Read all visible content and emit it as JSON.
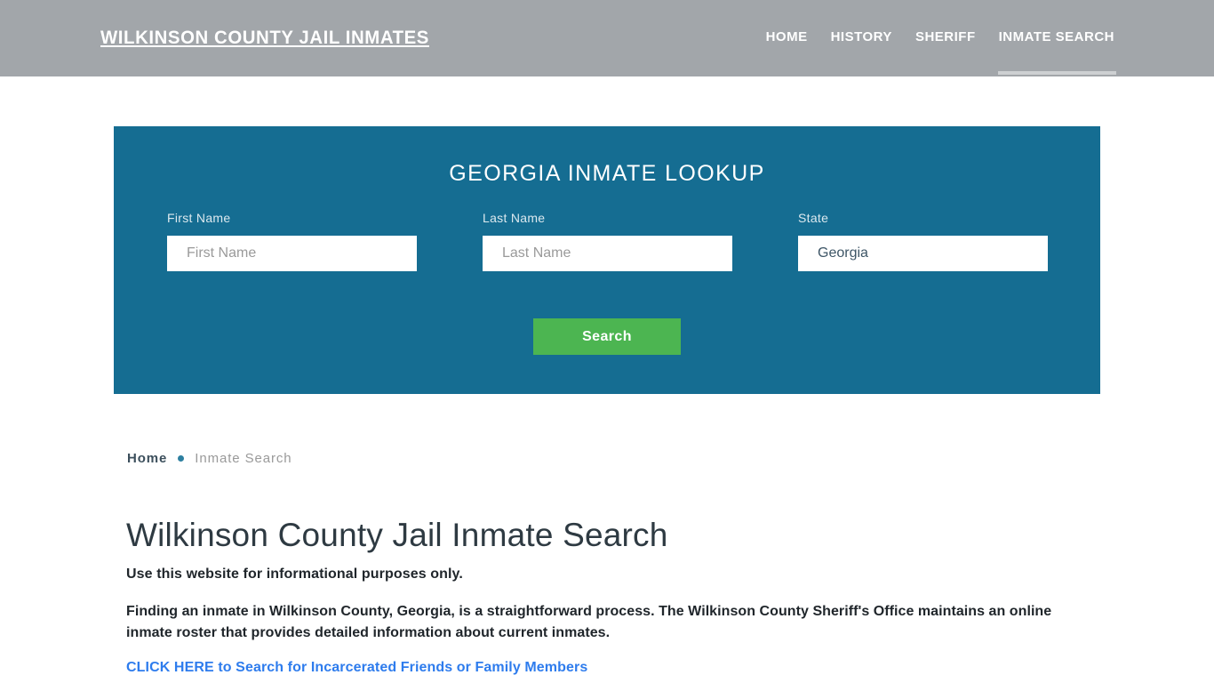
{
  "header": {
    "brand": "WILKINSON COUNTY JAIL INMATES",
    "background_color": "#a2a6aa",
    "nav": [
      {
        "label": "HOME",
        "active": false
      },
      {
        "label": "HISTORY",
        "active": false
      },
      {
        "label": "SHERIFF",
        "active": false
      },
      {
        "label": "INMATE SEARCH",
        "active": true
      }
    ]
  },
  "lookup": {
    "title": "GEORGIA INMATE LOOKUP",
    "panel_color": "#156d92",
    "fields": {
      "first_name": {
        "label": "First Name",
        "placeholder": "First Name",
        "value": ""
      },
      "last_name": {
        "label": "Last Name",
        "placeholder": "Last Name",
        "value": ""
      },
      "state": {
        "label": "State",
        "value": "Georgia",
        "options": [
          "Georgia"
        ]
      }
    },
    "search_button": {
      "label": "Search",
      "color": "#4cb551"
    }
  },
  "breadcrumb": {
    "home": "Home",
    "separator": "bullet-dot",
    "current": "Inmate Search"
  },
  "article": {
    "title": "Wilkinson County Jail Inmate Search",
    "lede": "Use this website for informational purposes only.",
    "paragraph": "Finding an inmate in Wilkinson County, Georgia, is a straightforward process. The Wilkinson County Sheriff's Office maintains an online inmate roster that provides detailed information about current inmates.",
    "cta_link": "CLICK HERE to Search for Incarcerated Friends or Family Members",
    "cta_color": "#2e7ced"
  }
}
